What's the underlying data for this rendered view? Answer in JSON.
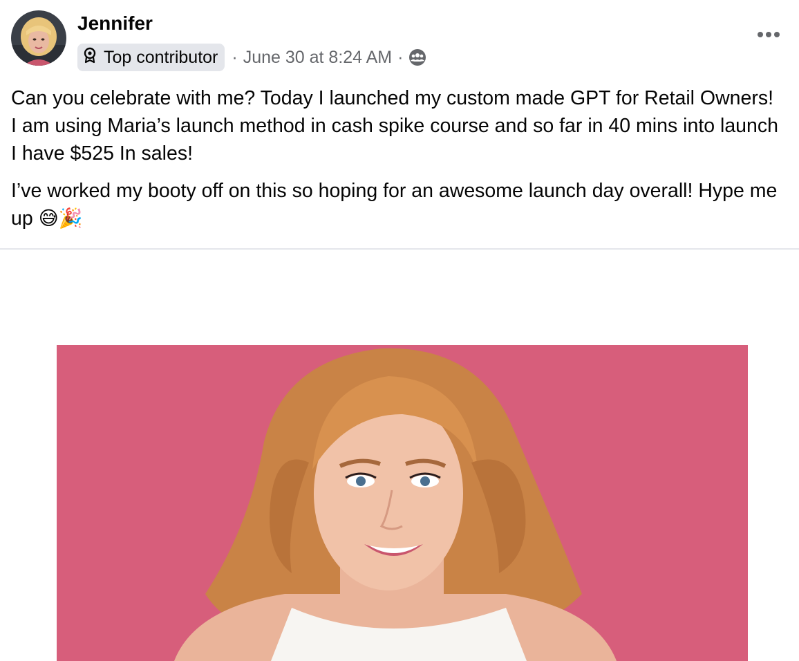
{
  "post": {
    "author": {
      "name": "Jennifer",
      "badge": "Top contributor",
      "avatar_icon": "profile-photo"
    },
    "meta": {
      "separator": "·",
      "timestamp": "June 30 at 8:24 AM",
      "audience_icon": "group-members-icon"
    },
    "more_options_icon": "ellipsis-icon",
    "text": {
      "paragraph1": "Can you celebrate with me? Today I launched my custom made GPT for Retail Owners! I am using Maria’s launch method in cash spike course and so far in 40 mins into launch I have $525 In sales!",
      "paragraph2": "I’ve worked my booty off on this so hoping for an awesome launch day overall! Hype me up",
      "emoji": "😅🎉"
    },
    "media": {
      "description_icon": "portrait-photo",
      "background_color": "#d75e7b"
    }
  },
  "colors": {
    "text_primary": "#050505",
    "text_secondary": "#65676b",
    "badge_bg": "#e4e6eb",
    "divider": "#e4e6eb"
  }
}
